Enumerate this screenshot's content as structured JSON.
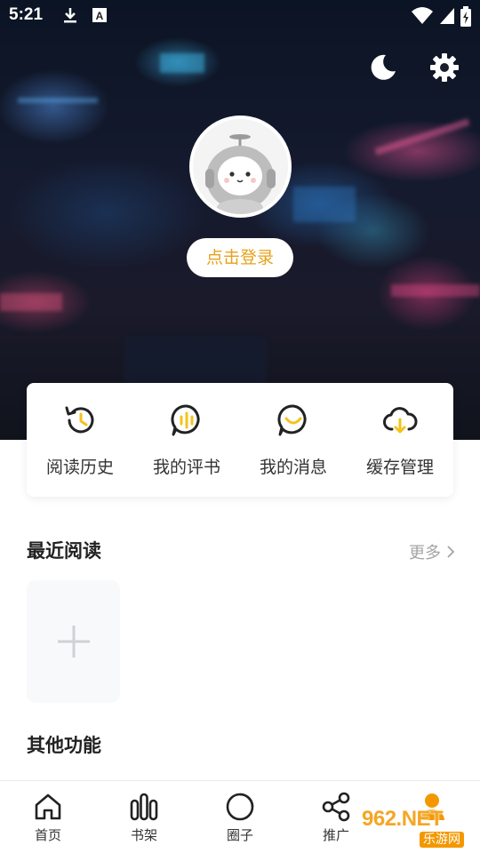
{
  "status_bar": {
    "time": "5:21",
    "icons": [
      "download-icon",
      "a-icon",
      "wifi-icon",
      "battery-icon"
    ]
  },
  "header": {
    "icons": [
      "moon-icon",
      "gear-icon"
    ]
  },
  "profile": {
    "login_label": "点击登录"
  },
  "quick_actions": [
    {
      "label": "阅读历史",
      "icon": "history-icon"
    },
    {
      "label": "我的评书",
      "icon": "voice-bubble-icon"
    },
    {
      "label": "我的消息",
      "icon": "message-icon"
    },
    {
      "label": "缓存管理",
      "icon": "cloud-download-icon"
    }
  ],
  "recent": {
    "title": "最近阅读",
    "more_label": "更多"
  },
  "other": {
    "title": "其他功能"
  },
  "bottom_nav": [
    {
      "label": "首页",
      "icon": "home-icon"
    },
    {
      "label": "书架",
      "icon": "shelf-icon"
    },
    {
      "label": "圈子",
      "icon": "circle-icon"
    },
    {
      "label": "推广",
      "icon": "share-icon"
    },
    {
      "label": "",
      "icon": "user-icon"
    }
  ],
  "watermark": {
    "logo": "962.NET",
    "sub": "乐游网"
  },
  "colors": {
    "accent": "#f39800",
    "login_text": "#e6a21a",
    "icon_yellow": "#f5c21b"
  }
}
